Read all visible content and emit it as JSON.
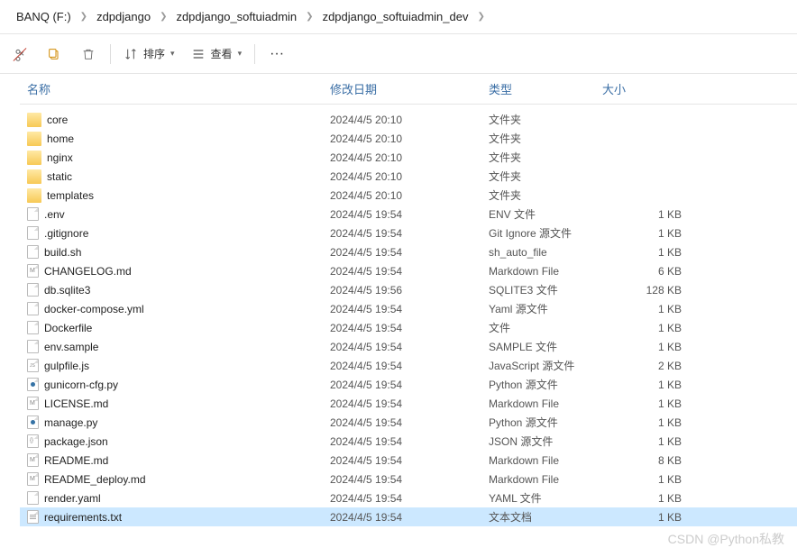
{
  "breadcrumb": [
    {
      "label": "BANQ (F:)"
    },
    {
      "label": "zdpdjango"
    },
    {
      "label": "zdpdjango_softuiadmin"
    },
    {
      "label": "zdpdjango_softuiadmin_dev"
    }
  ],
  "toolbar": {
    "sort_label": "排序",
    "view_label": "查看"
  },
  "columns": {
    "name": "名称",
    "date": "修改日期",
    "type": "类型",
    "size": "大小"
  },
  "files": [
    {
      "name": "core",
      "date": "2024/4/5 20:10",
      "type": "文件夹",
      "size": "",
      "icon": "fold"
    },
    {
      "name": "home",
      "date": "2024/4/5 20:10",
      "type": "文件夹",
      "size": "",
      "icon": "fold"
    },
    {
      "name": "nginx",
      "date": "2024/4/5 20:10",
      "type": "文件夹",
      "size": "",
      "icon": "fold"
    },
    {
      "name": "static",
      "date": "2024/4/5 20:10",
      "type": "文件夹",
      "size": "",
      "icon": "fold"
    },
    {
      "name": "templates",
      "date": "2024/4/5 20:10",
      "type": "文件夹",
      "size": "",
      "icon": "fold"
    },
    {
      "name": ".env",
      "date": "2024/4/5 19:54",
      "type": "ENV 文件",
      "size": "1 KB",
      "icon": "file"
    },
    {
      "name": ".gitignore",
      "date": "2024/4/5 19:54",
      "type": "Git Ignore 源文件",
      "size": "1 KB",
      "icon": "file"
    },
    {
      "name": "build.sh",
      "date": "2024/4/5 19:54",
      "type": "sh_auto_file",
      "size": "1 KB",
      "icon": "file"
    },
    {
      "name": "CHANGELOG.md",
      "date": "2024/4/5 19:54",
      "type": "Markdown File",
      "size": "6 KB",
      "icon": "file md"
    },
    {
      "name": "db.sqlite3",
      "date": "2024/4/5 19:56",
      "type": "SQLITE3 文件",
      "size": "128 KB",
      "icon": "file"
    },
    {
      "name": "docker-compose.yml",
      "date": "2024/4/5 19:54",
      "type": "Yaml 源文件",
      "size": "1 KB",
      "icon": "file"
    },
    {
      "name": "Dockerfile",
      "date": "2024/4/5 19:54",
      "type": "文件",
      "size": "1 KB",
      "icon": "file"
    },
    {
      "name": "env.sample",
      "date": "2024/4/5 19:54",
      "type": "SAMPLE 文件",
      "size": "1 KB",
      "icon": "file"
    },
    {
      "name": "gulpfile.js",
      "date": "2024/4/5 19:54",
      "type": "JavaScript 源文件",
      "size": "2 KB",
      "icon": "file js"
    },
    {
      "name": "gunicorn-cfg.py",
      "date": "2024/4/5 19:54",
      "type": "Python 源文件",
      "size": "1 KB",
      "icon": "file py"
    },
    {
      "name": "LICENSE.md",
      "date": "2024/4/5 19:54",
      "type": "Markdown File",
      "size": "1 KB",
      "icon": "file md"
    },
    {
      "name": "manage.py",
      "date": "2024/4/5 19:54",
      "type": "Python 源文件",
      "size": "1 KB",
      "icon": "file py"
    },
    {
      "name": "package.json",
      "date": "2024/4/5 19:54",
      "type": "JSON 源文件",
      "size": "1 KB",
      "icon": "file json"
    },
    {
      "name": "README.md",
      "date": "2024/4/5 19:54",
      "type": "Markdown File",
      "size": "8 KB",
      "icon": "file md"
    },
    {
      "name": "README_deploy.md",
      "date": "2024/4/5 19:54",
      "type": "Markdown File",
      "size": "1 KB",
      "icon": "file md"
    },
    {
      "name": "render.yaml",
      "date": "2024/4/5 19:54",
      "type": "YAML 文件",
      "size": "1 KB",
      "icon": "file"
    },
    {
      "name": "requirements.txt",
      "date": "2024/4/5 19:54",
      "type": "文本文档",
      "size": "1 KB",
      "icon": "file txt",
      "selected": true
    }
  ],
  "watermark": "CSDN @Python私教"
}
